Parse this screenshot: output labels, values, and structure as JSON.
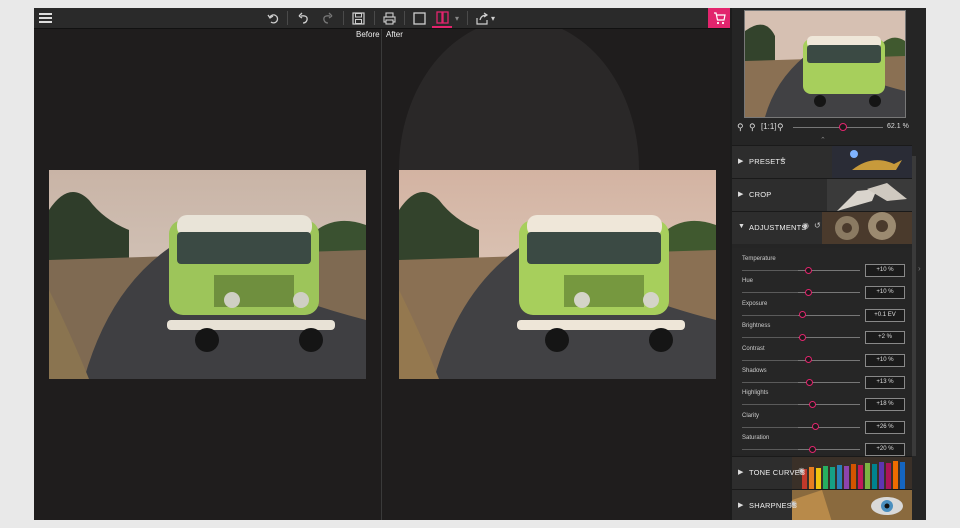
{
  "toolbar": {
    "menu_icon": "hamburger-icon",
    "undo_all_icon": "undo-all-icon",
    "undo_icon": "undo-icon",
    "redo_icon": "redo-icon",
    "save_icon": "save-icon",
    "print_icon": "print-icon",
    "single_view_icon": "single-view-icon",
    "split_view_icon": "split-view-icon",
    "split_dropdown": "▾",
    "share_icon": "share-icon",
    "share_dropdown": "▾",
    "before_label": "Before",
    "after_label": "After",
    "cart_icon": "cart-icon"
  },
  "navigator": {
    "zoom_value": "62.1 %",
    "zoom_level": 0.55
  },
  "panels": {
    "presets": "PRESETS",
    "crop": "CROP",
    "adjustments": "ADJUSTMENTS",
    "tone_curves": "TONE CURVES",
    "sharpness": "SHARPNESS"
  },
  "adjustments": [
    {
      "label": "Temperature",
      "value": "+10 %",
      "level": 0.56
    },
    {
      "label": "Hue",
      "value": "+10 %",
      "level": 0.56
    },
    {
      "label": "Exposure",
      "value": "+0.1 EV",
      "level": 0.51
    },
    {
      "label": "Brightness",
      "value": "+2 %",
      "level": 0.51
    },
    {
      "label": "Contrast",
      "value": "+10 %",
      "level": 0.56
    },
    {
      "label": "Shadows",
      "value": "+13 %",
      "level": 0.57
    },
    {
      "label": "Highlights",
      "value": "+18 %",
      "level": 0.59
    },
    {
      "label": "Clarity",
      "value": "+26 %",
      "level": 0.62
    },
    {
      "label": "Saturation",
      "value": "+20 %",
      "level": 0.59
    }
  ],
  "colors": {
    "accent": "#e2246d",
    "toolbar_bg": "#2a2a2a",
    "canvas_bg": "#1f1d1d",
    "van_body": "#9dc55a"
  }
}
